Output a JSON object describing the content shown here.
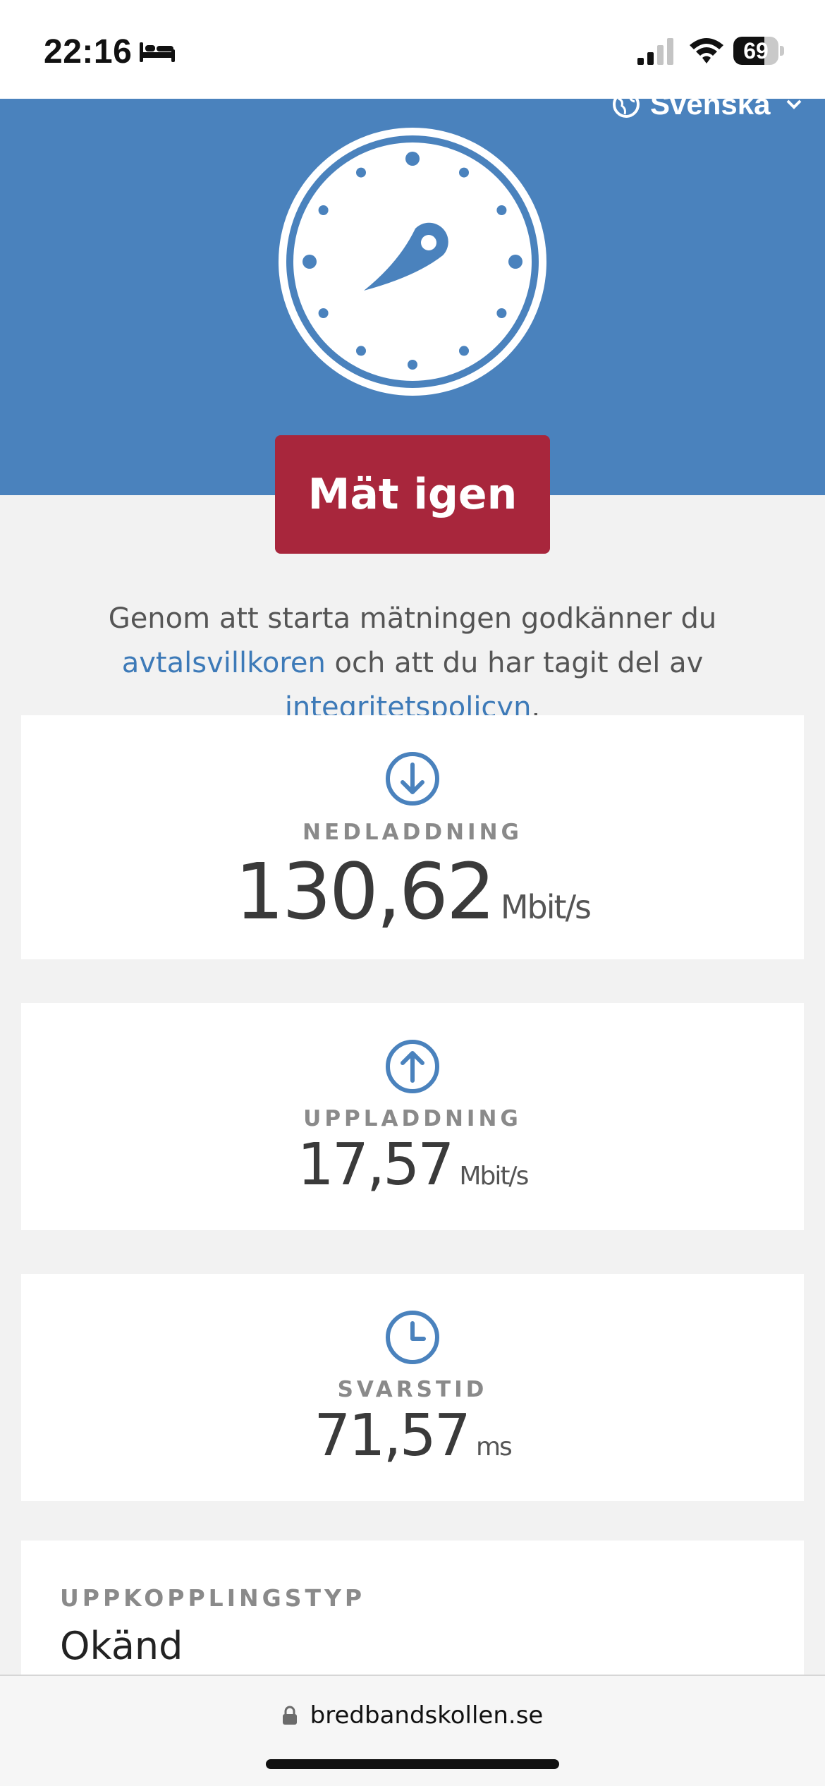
{
  "status_bar": {
    "time": "22:16",
    "battery_level": "69",
    "icons": [
      "bed-icon",
      "signal-icon",
      "wifi-icon",
      "battery-icon"
    ]
  },
  "header": {
    "language": "Svenska",
    "icons": [
      "globe-icon",
      "chevron-down-icon",
      "speedometer-icon"
    ]
  },
  "main": {
    "cta_label": "Mät igen",
    "terms": {
      "prefix": "Genom att starta mätningen godkänner du ",
      "link1": "avtalsvillkoren",
      "middle": " och att du har tagit del av ",
      "link2": "integritetspolicyn",
      "suffix": "."
    },
    "download": {
      "label": "NEDLADDNING",
      "value": "130,62",
      "unit": "Mbit/s",
      "icon": "arrow-down-circle-icon"
    },
    "upload": {
      "label": "UPPLADDNING",
      "value": "17,57",
      "unit": "Mbit/s",
      "icon": "arrow-up-circle-icon"
    },
    "latency": {
      "label": "SVARSTID",
      "value": "71,57",
      "unit": "ms",
      "icon": "clock-icon"
    },
    "connection": {
      "label": "UPPKOPPLINGSTYP",
      "value": "Okänd"
    }
  },
  "browser": {
    "url": "bredbandskollen.se",
    "icon": "lock-icon"
  },
  "colors": {
    "hero_blue": "#4a82bd",
    "accent_red": "#a8263c",
    "link_blue": "#3d7ab8",
    "icon_blue": "#4a82bd"
  }
}
